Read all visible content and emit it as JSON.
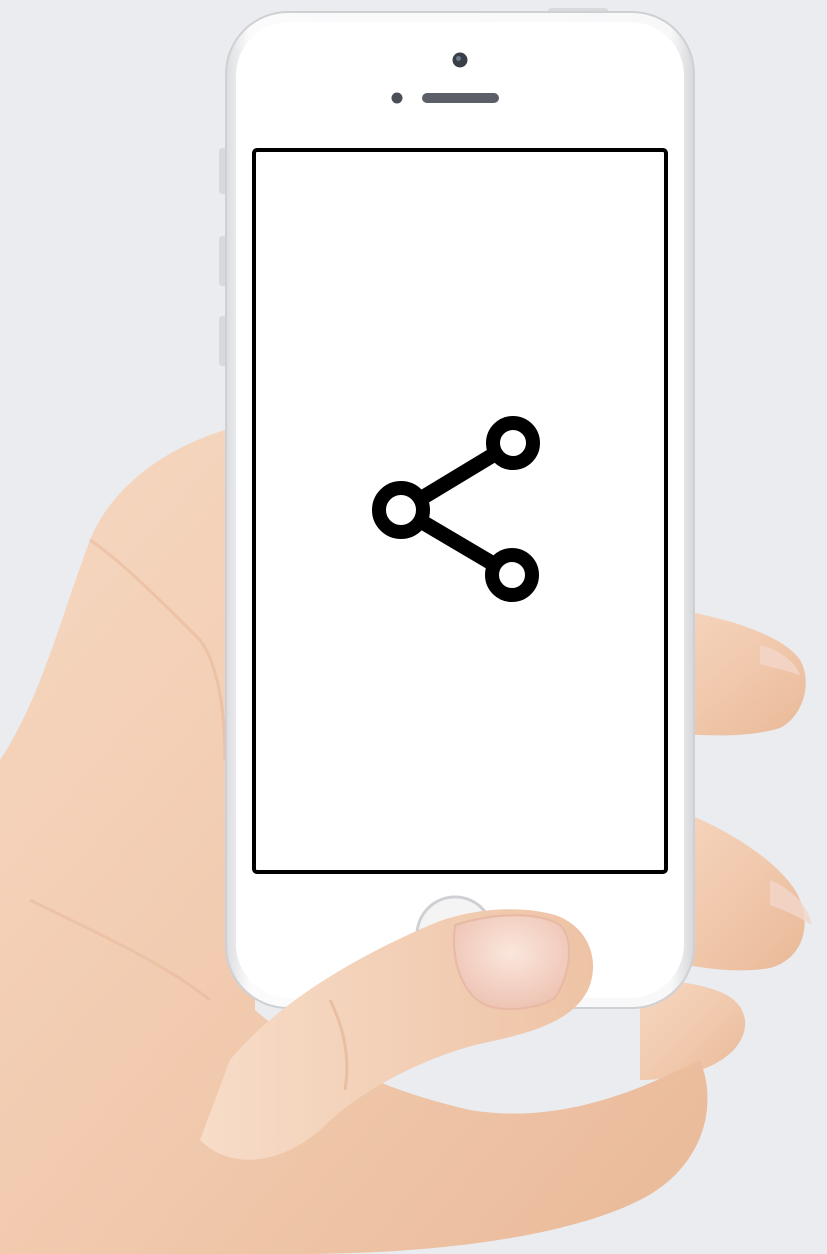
{
  "scene": {
    "background_color": "#eaecf0",
    "subject": "hand-holding-smartphone"
  },
  "phone": {
    "model_style": "white-smartphone",
    "body_color": "#f7f7f8",
    "bezel_color": "#ffffff",
    "screen": {
      "background_color": "#ffffff",
      "border_color": "#000000",
      "icon": {
        "name": "share-icon",
        "color": "#000000"
      }
    }
  },
  "hand": {
    "skin_color": "#f3cfb4"
  }
}
